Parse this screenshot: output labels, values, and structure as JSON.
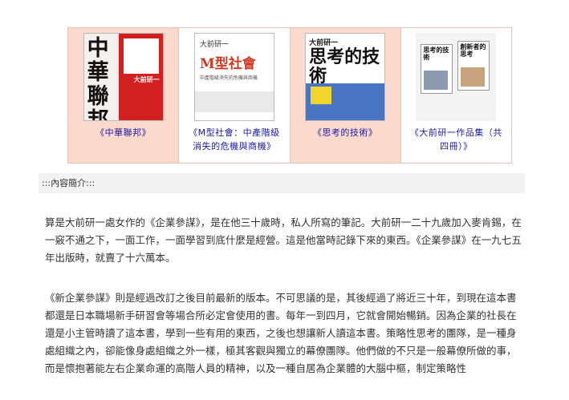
{
  "books": [
    {
      "caption": "《中華聯邦》",
      "cover_title": "中華聯邦",
      "cover_author": "大前研一"
    },
    {
      "caption": "《M型社會：中產階級消失的危機與商機》",
      "cover_top": "大前研一",
      "cover_title": "M型社會",
      "cover_sub": "中產階級消失的危機與商機"
    },
    {
      "caption": "《思考的技術》",
      "cover_top": "大前研一",
      "cover_title": "思考的技術"
    },
    {
      "caption": "《大前研一作品集（共四冊）》",
      "cover_items": [
        "思考的技術",
        "創新者的思考"
      ]
    }
  ],
  "section_title": ":::內容簡介:::",
  "paragraphs": [
    "算是大前研一處女作的《企業參謀》，是在他三十歲時，私人所寫的筆記。大前研一二十九歲加入麥肯錫，在一竅不通之下，一面工作，一面學習到底什麼是經營。這是他當時記錄下來的東西。《企業參謀》在一九七五年出版時，就賣了十六萬本。",
    "《新企業參謀》則是經過改訂之後目前最新的版本。不可思議的是，其後經過了將近三十年，到現在這本書都還是日本職場新手研習會等場合所必定會使用的書。每年一到四月，它就會開始暢銷。因為企業的社長在還是小主管時讀了這本書，學到一些有用的東西，之後也想讓新人讀這本書。策略性思考的團隊，是一種身處組織之內，卻能像身處組織之外一樣，極其客觀與獨立的幕僚團隊。他們做的不只是一般幕僚所做的事，而是懷抱著能左右企業命運的高階人員的精神，以及一種自居為企業體的大腦中樞，制定策略性"
  ]
}
